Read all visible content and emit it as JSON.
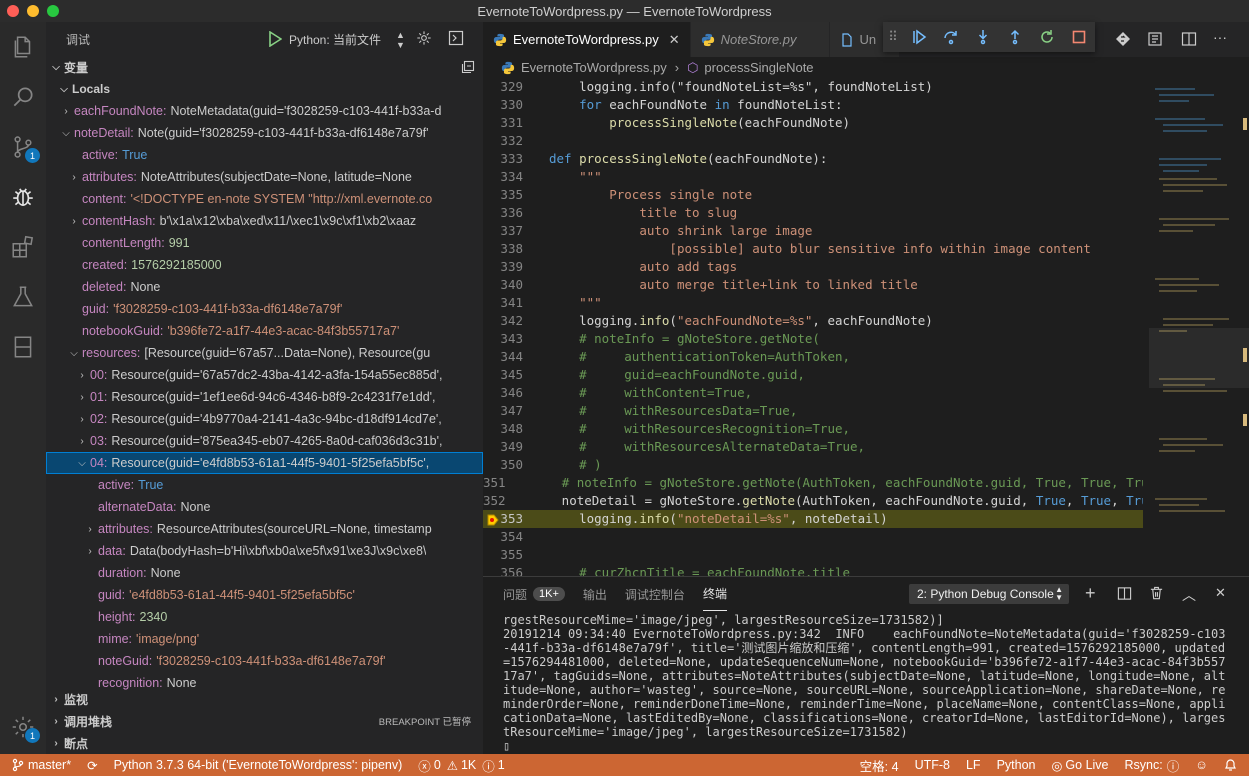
{
  "window": {
    "title": "EvernoteToWordpress.py — EvernoteToWordpress"
  },
  "colors": {
    "statusbar": "#cc6633",
    "accent": "#007fd4",
    "current_line": "#4b4b18"
  },
  "activity": {
    "scm_badge": "1",
    "accounts_badge": "1",
    "icons": [
      "explorer-icon",
      "search-icon",
      "source-control-icon",
      "debug-icon",
      "extensions-icon",
      "test-icon",
      "notebook-icon",
      "gear-icon"
    ]
  },
  "sidebar": {
    "title": "调试",
    "config": "Python: 当前文件",
    "variables_header": "变量",
    "locals_header": "Locals",
    "watch_header": "监视",
    "callstack_header": "调用堆栈",
    "callstack_status": "BREAKPOINT 已暂停",
    "breakpoints_header": "断点",
    "variables": [
      {
        "key": "eachFoundNote:",
        "value": "NoteMetadata(guid='f3028259-c103-441f-b33a-d",
        "kind": "obj",
        "indent": 1,
        "tw": ">"
      },
      {
        "key": "noteDetail:",
        "value": "Note(guid='f3028259-c103-441f-b33a-df6148e7a79f'",
        "kind": "obj",
        "indent": 1,
        "tw": "v"
      },
      {
        "key": "active:",
        "value": "True",
        "kind": "bool",
        "indent": 2,
        "tw": ""
      },
      {
        "key": "attributes:",
        "value": "NoteAttributes(subjectDate=None, latitude=None",
        "kind": "obj",
        "indent": 2,
        "tw": ">"
      },
      {
        "key": "content:",
        "value": "'<!DOCTYPE en-note SYSTEM \"http://xml.evernote.co",
        "kind": "str",
        "indent": 2,
        "tw": ""
      },
      {
        "key": "contentHash:",
        "value": "b'\\x1a\\x12\\xba\\xed\\x11/\\xec1\\x9c\\xf1\\xb2\\xaaz",
        "kind": "obj",
        "indent": 2,
        "tw": ">"
      },
      {
        "key": "contentLength:",
        "value": "991",
        "kind": "num",
        "indent": 2,
        "tw": ""
      },
      {
        "key": "created:",
        "value": "1576292185000",
        "kind": "num",
        "indent": 2,
        "tw": ""
      },
      {
        "key": "deleted:",
        "value": "None",
        "kind": "obj",
        "indent": 2,
        "tw": ""
      },
      {
        "key": "guid:",
        "value": "'f3028259-c103-441f-b33a-df6148e7a79f'",
        "kind": "str",
        "indent": 2,
        "tw": ""
      },
      {
        "key": "notebookGuid:",
        "value": "'b396fe72-a1f7-44e3-acac-84f3b55717a7'",
        "kind": "str",
        "indent": 2,
        "tw": ""
      },
      {
        "key": "resources:",
        "value": "[Resource(guid='67a57...Data=None), Resource(gu",
        "kind": "obj",
        "indent": 2,
        "tw": "v"
      },
      {
        "key": "00:",
        "value": "Resource(guid='67a57dc2-43ba-4142-a3fa-154a55ec885d',",
        "kind": "obj",
        "indent": 3,
        "tw": ">"
      },
      {
        "key": "01:",
        "value": "Resource(guid='1ef1ee6d-94c6-4346-b8f9-2c4231f7e1dd',",
        "kind": "obj",
        "indent": 3,
        "tw": ">"
      },
      {
        "key": "02:",
        "value": "Resource(guid='4b9770a4-2141-4a3c-94bc-d18df914cd7e',",
        "kind": "obj",
        "indent": 3,
        "tw": ">"
      },
      {
        "key": "03:",
        "value": "Resource(guid='875ea345-eb07-4265-8a0d-caf036d3c31b',",
        "kind": "obj",
        "indent": 3,
        "tw": ">"
      },
      {
        "key": "04:",
        "value": "Resource(guid='e4fd8b53-61a1-44f5-9401-5f25efa5bf5c',",
        "kind": "obj",
        "indent": 3,
        "tw": "v",
        "selected": true
      },
      {
        "key": "active:",
        "value": "True",
        "kind": "bool",
        "indent": 4,
        "tw": ""
      },
      {
        "key": "alternateData:",
        "value": "None",
        "kind": "obj",
        "indent": 4,
        "tw": ""
      },
      {
        "key": "attributes:",
        "value": "ResourceAttributes(sourceURL=None, timestamp",
        "kind": "obj",
        "indent": 4,
        "tw": ">"
      },
      {
        "key": "data:",
        "value": "Data(bodyHash=b'Hi\\xbf\\xb0a\\xe5f\\x91\\xe3J\\x9c\\xe8\\",
        "kind": "obj",
        "indent": 4,
        "tw": ">"
      },
      {
        "key": "duration:",
        "value": "None",
        "kind": "obj",
        "indent": 4,
        "tw": ""
      },
      {
        "key": "guid:",
        "value": "'e4fd8b53-61a1-44f5-9401-5f25efa5bf5c'",
        "kind": "str",
        "indent": 4,
        "tw": ""
      },
      {
        "key": "height:",
        "value": "2340",
        "kind": "num",
        "indent": 4,
        "tw": ""
      },
      {
        "key": "mime:",
        "value": "'image/png'",
        "kind": "str",
        "indent": 4,
        "tw": ""
      },
      {
        "key": "noteGuid:",
        "value": "'f3028259-c103-441f-b33a-df6148e7a79f'",
        "kind": "str",
        "indent": 4,
        "tw": ""
      },
      {
        "key": "recognition:",
        "value": "None",
        "kind": "obj",
        "indent": 4,
        "tw": ""
      }
    ]
  },
  "editor": {
    "tabs": [
      {
        "label": "EvernoteToWordpress.py",
        "active": true
      },
      {
        "label": "NoteStore.py",
        "active": false
      },
      {
        "label": "Un",
        "active": false
      }
    ],
    "breadcrumb": {
      "file": "EvernoteToWordpress.py",
      "symbol": "processSingleNote"
    },
    "current_line": 353,
    "lines": [
      {
        "n": "329",
        "html": "    logging.info(\"foundNoteList=%s\", foundNoteList)"
      },
      {
        "n": "330",
        "html": "    <span class=\"kw\">for</span> eachFoundNote <span class=\"kw\">in</span> foundNoteList:"
      },
      {
        "n": "331",
        "html": "        <span class=\"fn\">processSingleNote</span>(eachFoundNote)"
      },
      {
        "n": "332",
        "html": ""
      },
      {
        "n": "333",
        "html": "<span class=\"kw\">def</span> <span class=\"fn\">processSingleNote</span>(eachFoundNote):"
      },
      {
        "n": "334",
        "html": "    <span class=\"st\">\"\"\"</span>"
      },
      {
        "n": "335",
        "html": "        <span class=\"st\">Process single note</span>"
      },
      {
        "n": "336",
        "html": "            <span class=\"st\">title to slug</span>"
      },
      {
        "n": "337",
        "html": "            <span class=\"st\">auto shrink large image</span>"
      },
      {
        "n": "338",
        "html": "                <span class=\"st\">[possible] auto blur sensitive info within image content</span>"
      },
      {
        "n": "339",
        "html": "            <span class=\"st\">auto add tags</span>"
      },
      {
        "n": "340",
        "html": "            <span class=\"st\">auto merge title+link to linked title</span>"
      },
      {
        "n": "341",
        "html": "    <span class=\"st\">\"\"\"</span>"
      },
      {
        "n": "342",
        "html": "    logging.<span class=\"fn\">info</span>(<span class=\"st\">\"eachFoundNote=%s\"</span>, eachFoundNote)"
      },
      {
        "n": "343",
        "html": "    <span class=\"cm\"># noteInfo = gNoteStore.getNote(</span>"
      },
      {
        "n": "344",
        "html": "    <span class=\"cm\">#     authenticationToken=AuthToken,</span>"
      },
      {
        "n": "345",
        "html": "    <span class=\"cm\">#     guid=eachFoundNote.guid,</span>"
      },
      {
        "n": "346",
        "html": "    <span class=\"cm\">#     withContent=True,</span>"
      },
      {
        "n": "347",
        "html": "    <span class=\"cm\">#     withResourcesData=True,</span>"
      },
      {
        "n": "348",
        "html": "    <span class=\"cm\">#     withResourcesRecognition=True,</span>"
      },
      {
        "n": "349",
        "html": "    <span class=\"cm\">#     withResourcesAlternateData=True,</span>"
      },
      {
        "n": "350",
        "html": "    <span class=\"cm\"># )</span>"
      },
      {
        "n": "351",
        "html": "    <span class=\"cm\"># noteInfo = gNoteStore.getNote(AuthToken, eachFoundNote.guid, True, True, True</span>"
      },
      {
        "n": "352",
        "html": "    noteDetail = gNoteStore.<span class=\"fn\">getNote</span>(AuthToken, eachFoundNote.guid, <span class=\"kw\">True</span>, <span class=\"kw\">True</span>, <span class=\"kw\">True</span>"
      },
      {
        "n": "353",
        "html": "    logging.<span class=\"fn\">info</span>(<span class=\"st\">\"noteDetail=%s\"</span>, noteDetail)"
      },
      {
        "n": "354",
        "html": ""
      },
      {
        "n": "355",
        "html": ""
      },
      {
        "n": "356",
        "html": "    <span class=\"cm\"># curZhcnTitle = eachFoundNote.title</span>"
      }
    ]
  },
  "panel": {
    "tabs": [
      {
        "label": "问题",
        "badge": "1K+",
        "active": false
      },
      {
        "label": "输出",
        "active": false
      },
      {
        "label": "调试控制台",
        "active": false
      },
      {
        "label": "终端",
        "active": true
      }
    ],
    "terminal_select": "2: Python Debug Console",
    "terminal_text": "rgestResourceMime='image/jpeg', largestResourceSize=1731582)]\n20191214 09:34:40 EvernoteToWordpress.py:342  INFO    eachFoundNote=NoteMetadata(guid='f3028259-c103-441f-b33a-df6148e7a79f', title='测试图片缩放和压缩', contentLength=991, created=1576292185000, updated=1576294481000, deleted=None, updateSequenceNum=None, notebookGuid='b396fe72-a1f7-44e3-acac-84f3b55717a7', tagGuids=None, attributes=NoteAttributes(subjectDate=None, latitude=None, longitude=None, altitude=None, author='wasteg', source=None, sourceURL=None, sourceApplication=None, shareDate=None, reminderOrder=None, reminderDoneTime=None, reminderTime=None, placeName=None, contentClass=None, applicationData=None, lastEditedBy=None, classifications=None, creatorId=None, lastEditorId=None), largestResourceMime='image/jpeg', largestResourceSize=1731582)\n▯"
  },
  "statusbar": {
    "branch": "master*",
    "interpreter": "Python 3.7.3 64-bit ('EvernoteToWordpress': pipenv)",
    "errors": "0",
    "warnings": "1K",
    "info": "1",
    "spaces": "空格: 4",
    "encoding": "UTF-8",
    "eol": "LF",
    "language": "Python",
    "golive": "Go Live",
    "rsync": "Rsync:"
  }
}
